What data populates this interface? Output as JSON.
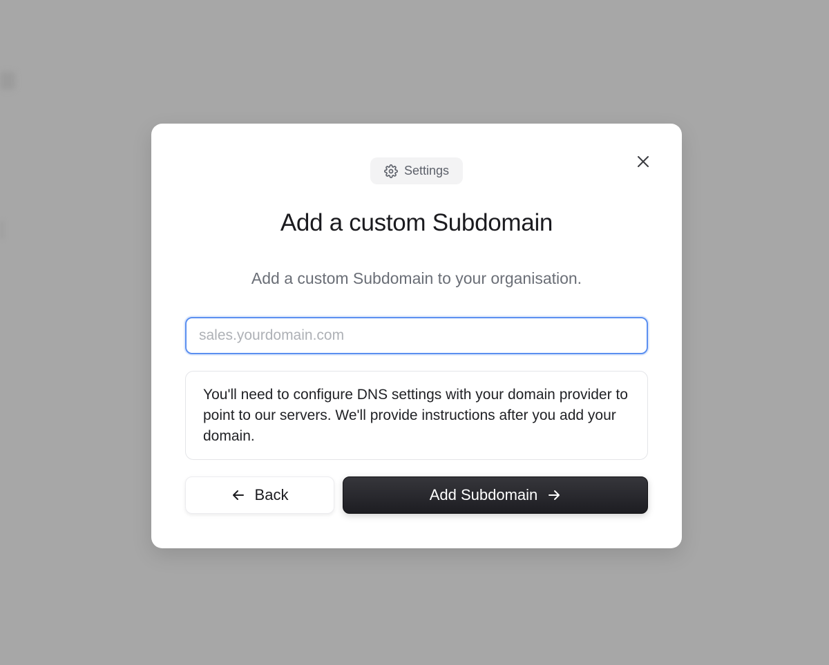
{
  "modal": {
    "badge_label": "Settings",
    "badge_icon": "gear-icon",
    "title": "Add a custom Subdomain",
    "subtitle": "Add a custom Subdomain to your organisation.",
    "input": {
      "placeholder": "sales.yourdomain.com",
      "value": ""
    },
    "info_text": "You'll need to configure DNS settings with your domain provider to point to our servers. We'll provide instructions after you add your domain.",
    "back_label": "Back",
    "submit_label": "Add Subdomain",
    "close_icon": "close-icon"
  },
  "colors": {
    "backdrop": "#a7a7a7",
    "focus_ring": "#5b8ff0",
    "primary_button": "#1d1d22"
  }
}
